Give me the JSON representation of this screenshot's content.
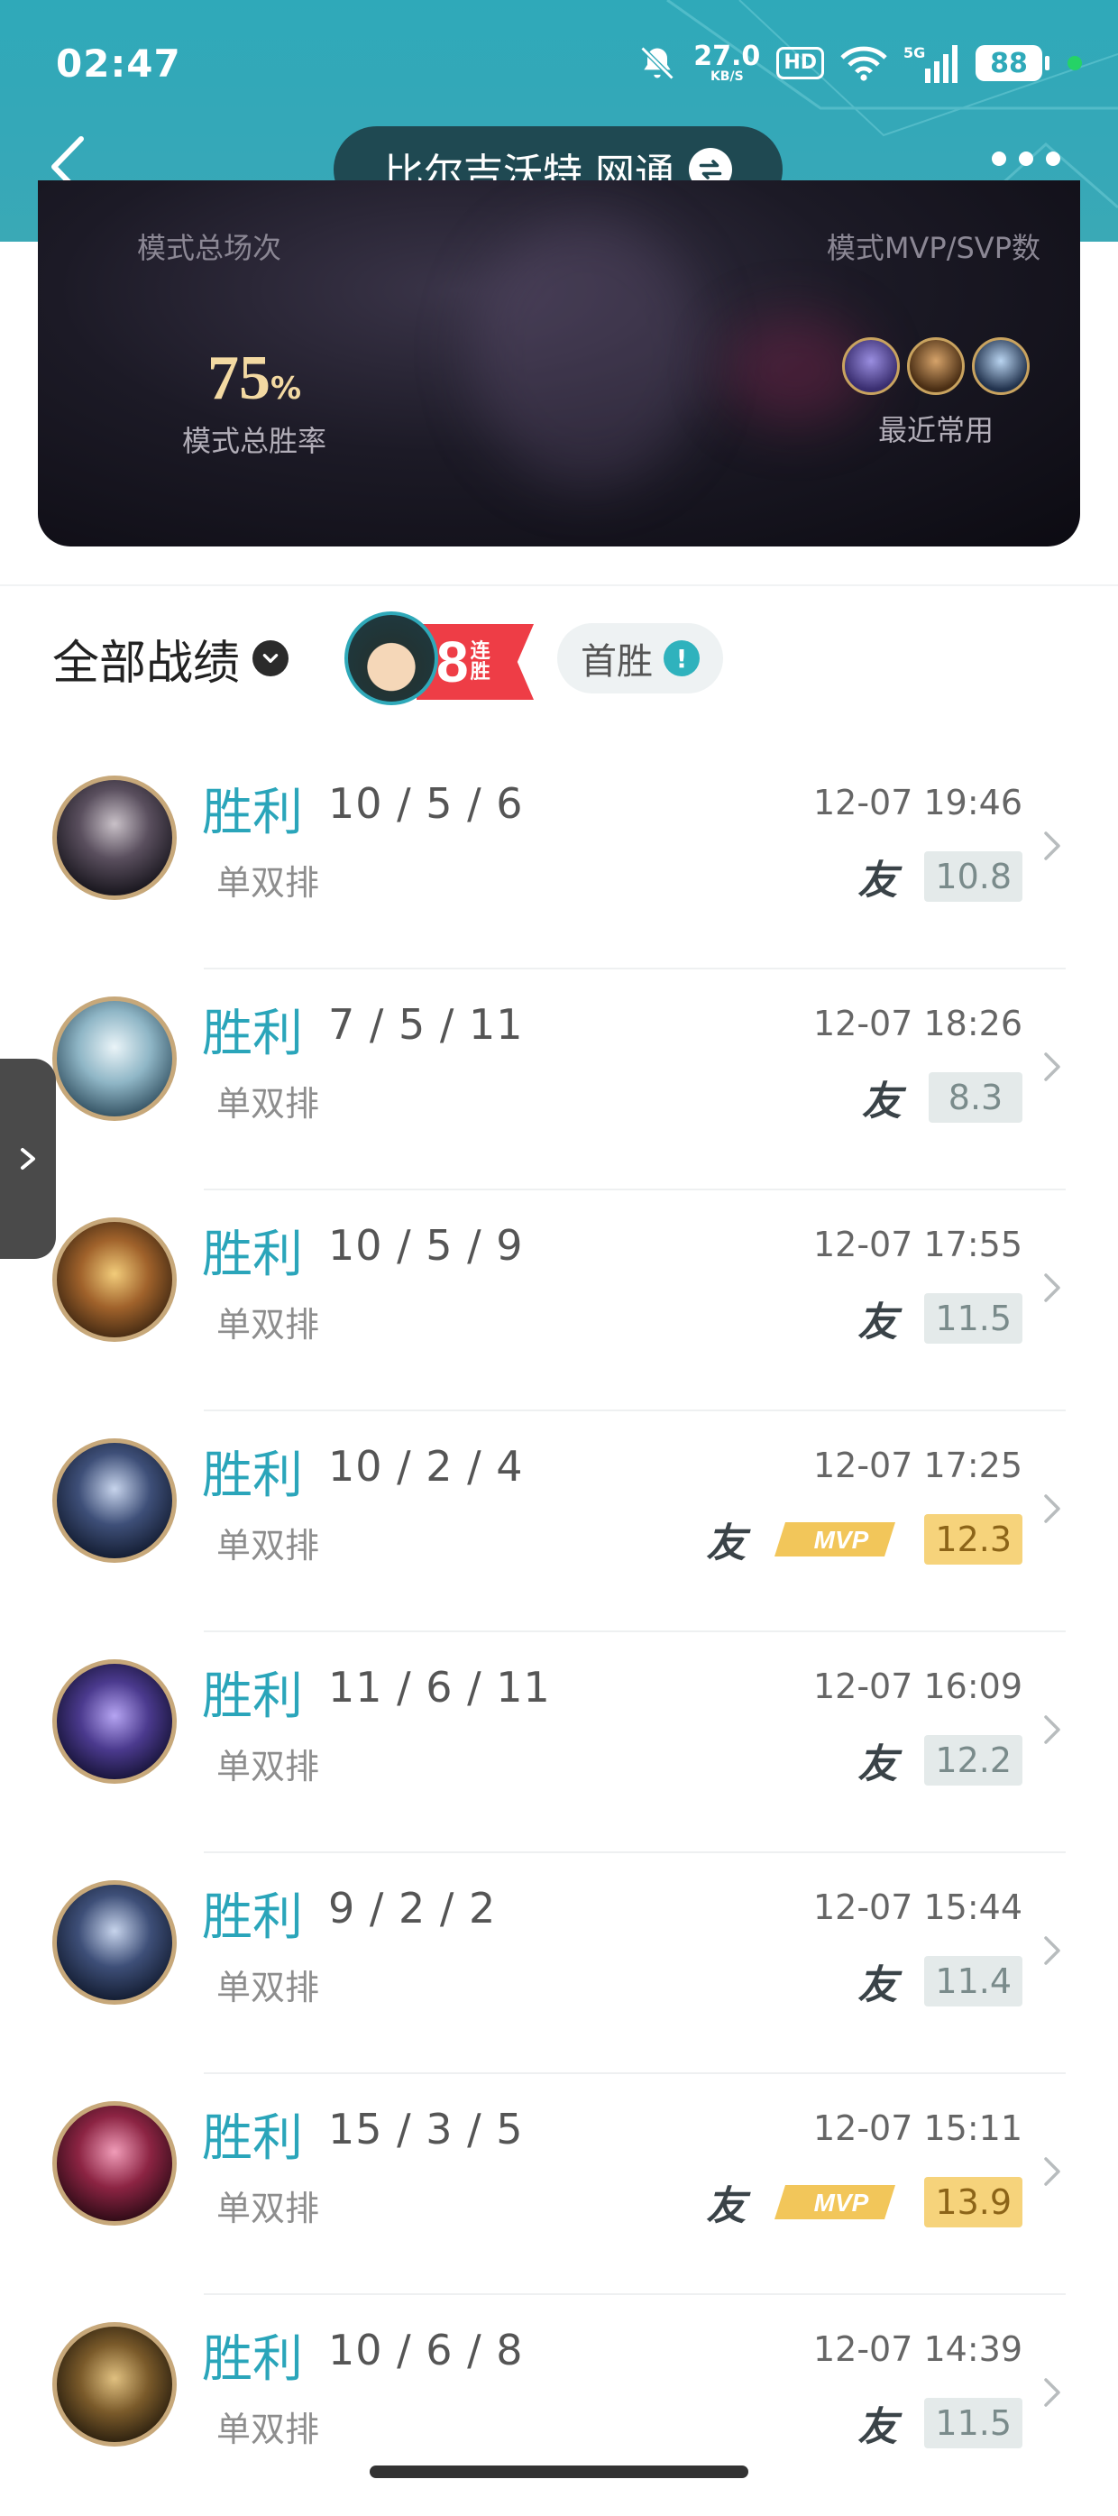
{
  "status_bar": {
    "time": "02:47",
    "net_speed_value": "27.0",
    "net_speed_unit": "KB/S",
    "hd": "HD",
    "network_type": "5G",
    "battery": "88"
  },
  "header": {
    "server_name": "比尔吉沃特 网通"
  },
  "stats_card": {
    "total_matches_label": "模式总场次",
    "mvp_label": "模式MVP/SVP数",
    "win_rate_value": "75",
    "win_rate_unit": "%",
    "win_rate_label": "模式总胜率",
    "recent_label": "最近常用"
  },
  "filter": {
    "all_records_label": "全部战绩",
    "streak_number": "8",
    "streak_text": "连胜",
    "first_win_label": "首胜",
    "first_win_info": "!"
  },
  "colors": {
    "accent": "#2fa9b9",
    "win_text": "#2aa5ba",
    "streak_red": "#ee3d46",
    "mvp_gold": "#f6d37b"
  },
  "matches": [
    {
      "result": "胜利",
      "kda": "10 / 5 / 6",
      "mode": "单双排",
      "time": "12-07 19:46",
      "friend": "友",
      "score": "10.8",
      "mvp": false,
      "champion": "viego"
    },
    {
      "result": "胜利",
      "kda": "7 / 5 / 11",
      "mode": "单双排",
      "time": "12-07 18:26",
      "friend": "友",
      "score": "8.3",
      "mvp": false,
      "champion": "gwen"
    },
    {
      "result": "胜利",
      "kda": "10 / 5 / 9",
      "mode": "单双排",
      "time": "12-07 17:55",
      "friend": "友",
      "score": "11.5",
      "mvp": false,
      "champion": "ziggs"
    },
    {
      "result": "胜利",
      "kda": "10 / 2 / 4",
      "mode": "单双排",
      "time": "12-07 17:25",
      "friend": "友",
      "score": "12.3",
      "mvp": true,
      "mvp_label": "MVP",
      "champion": "talon"
    },
    {
      "result": "胜利",
      "kda": "11 / 6 / 11",
      "mode": "单双排",
      "time": "12-07 16:09",
      "friend": "友",
      "score": "12.2",
      "mvp": false,
      "champion": "vex"
    },
    {
      "result": "胜利",
      "kda": "9 / 2 / 2",
      "mode": "单双排",
      "time": "12-07 15:44",
      "friend": "友",
      "score": "11.4",
      "mvp": false,
      "champion": "talon"
    },
    {
      "result": "胜利",
      "kda": "15 / 3 / 5",
      "mode": "单双排",
      "time": "12-07 15:11",
      "friend": "友",
      "score": "13.9",
      "mvp": true,
      "mvp_label": "MVP",
      "champion": "xayah"
    },
    {
      "result": "胜利",
      "kda": "10 / 6 / 8",
      "mode": "单双排",
      "time": "12-07 14:39",
      "friend": "友",
      "score": "11.5",
      "mvp": false,
      "champion": "rengar"
    }
  ]
}
